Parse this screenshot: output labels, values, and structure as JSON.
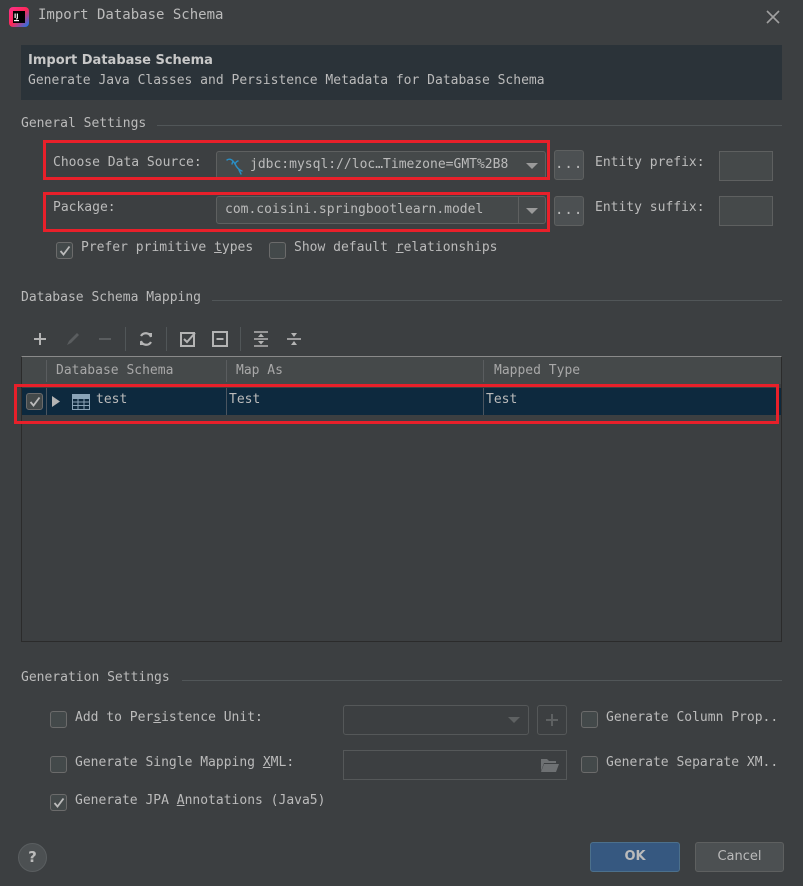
{
  "window": {
    "title": "Import Database Schema",
    "app_icon": "intellij-idea-icon",
    "close_icon": "close-icon"
  },
  "banner": {
    "title": "Import Database Schema",
    "subtitle": "Generate Java Classes and Persistence Metadata for Database Schema"
  },
  "general_settings": {
    "section_title": "General Settings",
    "data_source_label": "Choose Data Source:",
    "data_source_value": "jdbc:mysql://loc…Timezone=GMT%2B8",
    "data_source_icon": "mysql-dolphin-icon",
    "package_label": "Package:",
    "package_value": "com.coisini.springbootlearn.model",
    "browse_label": "...",
    "entity_prefix_label": "Entity prefix:",
    "entity_prefix_value": "",
    "entity_suffix_label": "Entity suffix:",
    "entity_suffix_value": "",
    "prefer_primitive": {
      "label_pre": "Prefer primitive ",
      "label_mnemonic": "t",
      "label_post": "ypes",
      "checked": true
    },
    "show_default_rel": {
      "label_pre": "Show default ",
      "label_mnemonic": "r",
      "label_post": "elationships",
      "checked": false
    }
  },
  "mapping": {
    "section_title": "Database Schema Mapping",
    "toolbar": [
      {
        "name": "add-icon",
        "enabled": true
      },
      {
        "name": "edit-icon",
        "enabled": false
      },
      {
        "name": "remove-icon",
        "enabled": false
      },
      {
        "name": "refresh-icon",
        "enabled": true
      },
      {
        "name": "select-all-icon",
        "enabled": true
      },
      {
        "name": "unselect-all-icon",
        "enabled": true
      },
      {
        "name": "expand-all-icon",
        "enabled": true
      },
      {
        "name": "collapse-all-icon",
        "enabled": true
      }
    ],
    "columns": [
      "Database Schema",
      "Map As",
      "Mapped Type"
    ],
    "rows": [
      {
        "checked": true,
        "schema": "test",
        "map_as": "Test",
        "mapped_type": "Test",
        "selected": true
      }
    ]
  },
  "generation_settings": {
    "section_title": "Generation Settings",
    "add_to_pu": {
      "label_pre": "Add to Per",
      "label_mnemonic": "s",
      "label_post": "istence Unit:",
      "checked": false,
      "value": ""
    },
    "single_mapping_xml": {
      "label_pre": "Generate Single Mapping ",
      "label_mnemonic": "X",
      "label_post": "ML:",
      "checked": false,
      "value": ""
    },
    "jpa_annotations": {
      "label_pre": "Generate JPA ",
      "label_mnemonic": "A",
      "label_post": "nnotations (Java5)",
      "checked": true
    },
    "column_props": {
      "label": "Generate Column Prop..",
      "checked": false
    },
    "separate_xml": {
      "label": "Generate Separate XM..",
      "checked": false
    }
  },
  "footer": {
    "help_label": "?",
    "ok_label": "OK",
    "cancel_label": "Cancel"
  },
  "colors": {
    "background": "#3c3f41",
    "banner": "#2b3339",
    "selection": "#0d293e",
    "ok_button": "#365880",
    "highlight_box": "#e8202a",
    "mysql_icon": "#2a8ec4"
  }
}
